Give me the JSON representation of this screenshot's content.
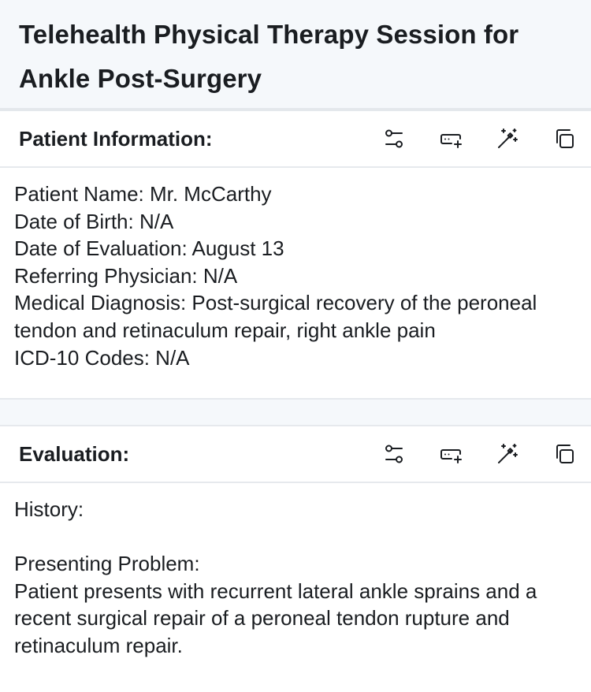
{
  "page": {
    "title": "Telehealth Physical Therapy Session for Ankle Post-Surgery"
  },
  "sections": [
    {
      "title": "Patient Information:",
      "lines": [
        "Patient Name: Mr. McCarthy",
        "Date of Birth: N/A",
        "Date of Evaluation: August 13",
        "Referring Physician: N/A",
        "Medical Diagnosis: Post-surgical recovery of the peroneal tendon and retinaculum repair, right ankle pain",
        "ICD-10 Codes: N/A"
      ]
    },
    {
      "title": "Evaluation:",
      "history_label": "History:",
      "problem_label": "Presenting Problem:",
      "problem_text": "Patient presents with recurrent lateral ankle sprains and a recent surgical repair of a peroneal tendon rupture and retinaculum repair."
    }
  ],
  "icons": [
    "sliders-icon",
    "add-field-icon",
    "magic-wand-icon",
    "copy-icon"
  ]
}
